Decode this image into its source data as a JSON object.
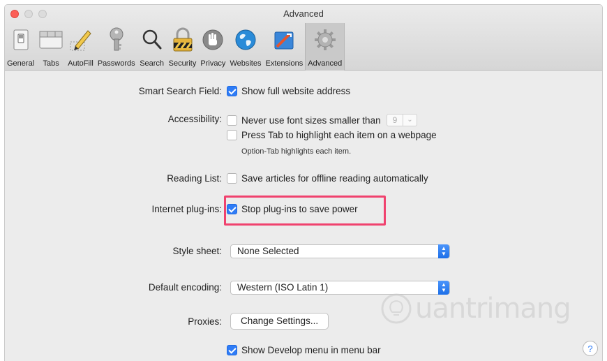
{
  "window": {
    "title": "Advanced"
  },
  "toolbar": {
    "tabs": [
      {
        "label": "General",
        "icon": "general-switch-icon"
      },
      {
        "label": "Tabs",
        "icon": "tabs-icon"
      },
      {
        "label": "AutoFill",
        "icon": "pencil-icon"
      },
      {
        "label": "Passwords",
        "icon": "key-icon"
      },
      {
        "label": "Search",
        "icon": "magnifier-icon"
      },
      {
        "label": "Security",
        "icon": "padlock-icon"
      },
      {
        "label": "Privacy",
        "icon": "hand-icon"
      },
      {
        "label": "Websites",
        "icon": "globe-icon"
      },
      {
        "label": "Extensions",
        "icon": "puzzle-icon"
      },
      {
        "label": "Advanced",
        "icon": "gear-icon"
      }
    ],
    "active_tab": "Advanced"
  },
  "settings": {
    "smart_search": {
      "label": "Smart Search Field:",
      "option": "Show full website address",
      "checked": true
    },
    "accessibility": {
      "label": "Accessibility:",
      "font_option": "Never use font sizes smaller than",
      "font_size": "9",
      "font_checked": false,
      "tab_option": "Press Tab to highlight each item on a webpage",
      "tab_checked": false,
      "note": "Option-Tab highlights each item."
    },
    "reading_list": {
      "label": "Reading List:",
      "option": "Save articles for offline reading automatically",
      "checked": false
    },
    "plugins": {
      "label": "Internet plug-ins:",
      "option": "Stop plug-ins to save power",
      "checked": true
    },
    "style_sheet": {
      "label": "Style sheet:",
      "value": "None Selected"
    },
    "encoding": {
      "label": "Default encoding:",
      "value": "Western (ISO Latin 1)"
    },
    "proxies": {
      "label": "Proxies:",
      "button": "Change Settings..."
    },
    "develop": {
      "option": "Show Develop menu in menu bar",
      "checked": true
    }
  },
  "help": {
    "label": "?"
  },
  "watermark": {
    "text": "uantrimang"
  },
  "colors": {
    "accent": "#2f7cf6",
    "highlight_border": "#f0426e",
    "close_button": "#fc5f57"
  }
}
